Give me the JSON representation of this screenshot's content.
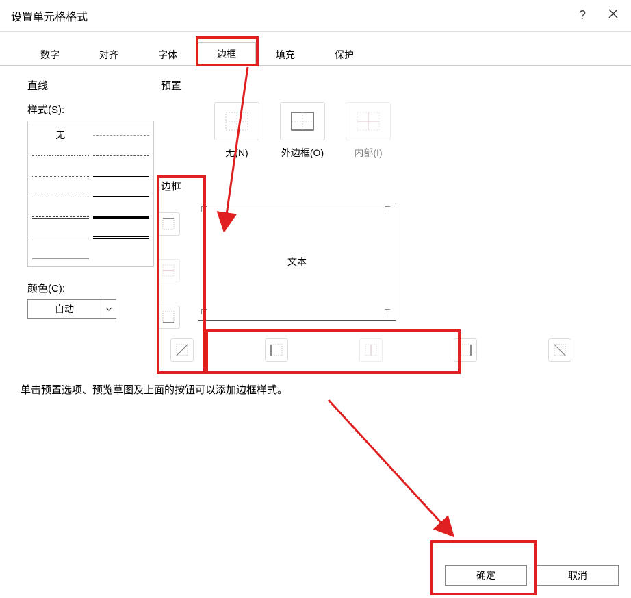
{
  "titlebar": {
    "title": "设置单元格格式"
  },
  "tabs": {
    "number": "数字",
    "align": "对齐",
    "font": "字体",
    "border": "边框",
    "fill": "填充",
    "protect": "保护",
    "active": "border"
  },
  "line": {
    "section": "直线",
    "style_label": "样式(S):",
    "none": "无",
    "color_label": "颜色(C):",
    "color_value": "自动"
  },
  "presets": {
    "section": "预置",
    "none": "无(N)",
    "none_letter": "N",
    "outline": "外边框(O)",
    "outline_letter": "O",
    "inside": "内部(I)",
    "inside_letter": "I"
  },
  "border": {
    "section": "边框",
    "preview_text": "文本"
  },
  "hint": "单击预置选项、预览草图及上面的按钮可以添加边框样式。",
  "footer": {
    "ok": "确定",
    "cancel": "取消"
  }
}
